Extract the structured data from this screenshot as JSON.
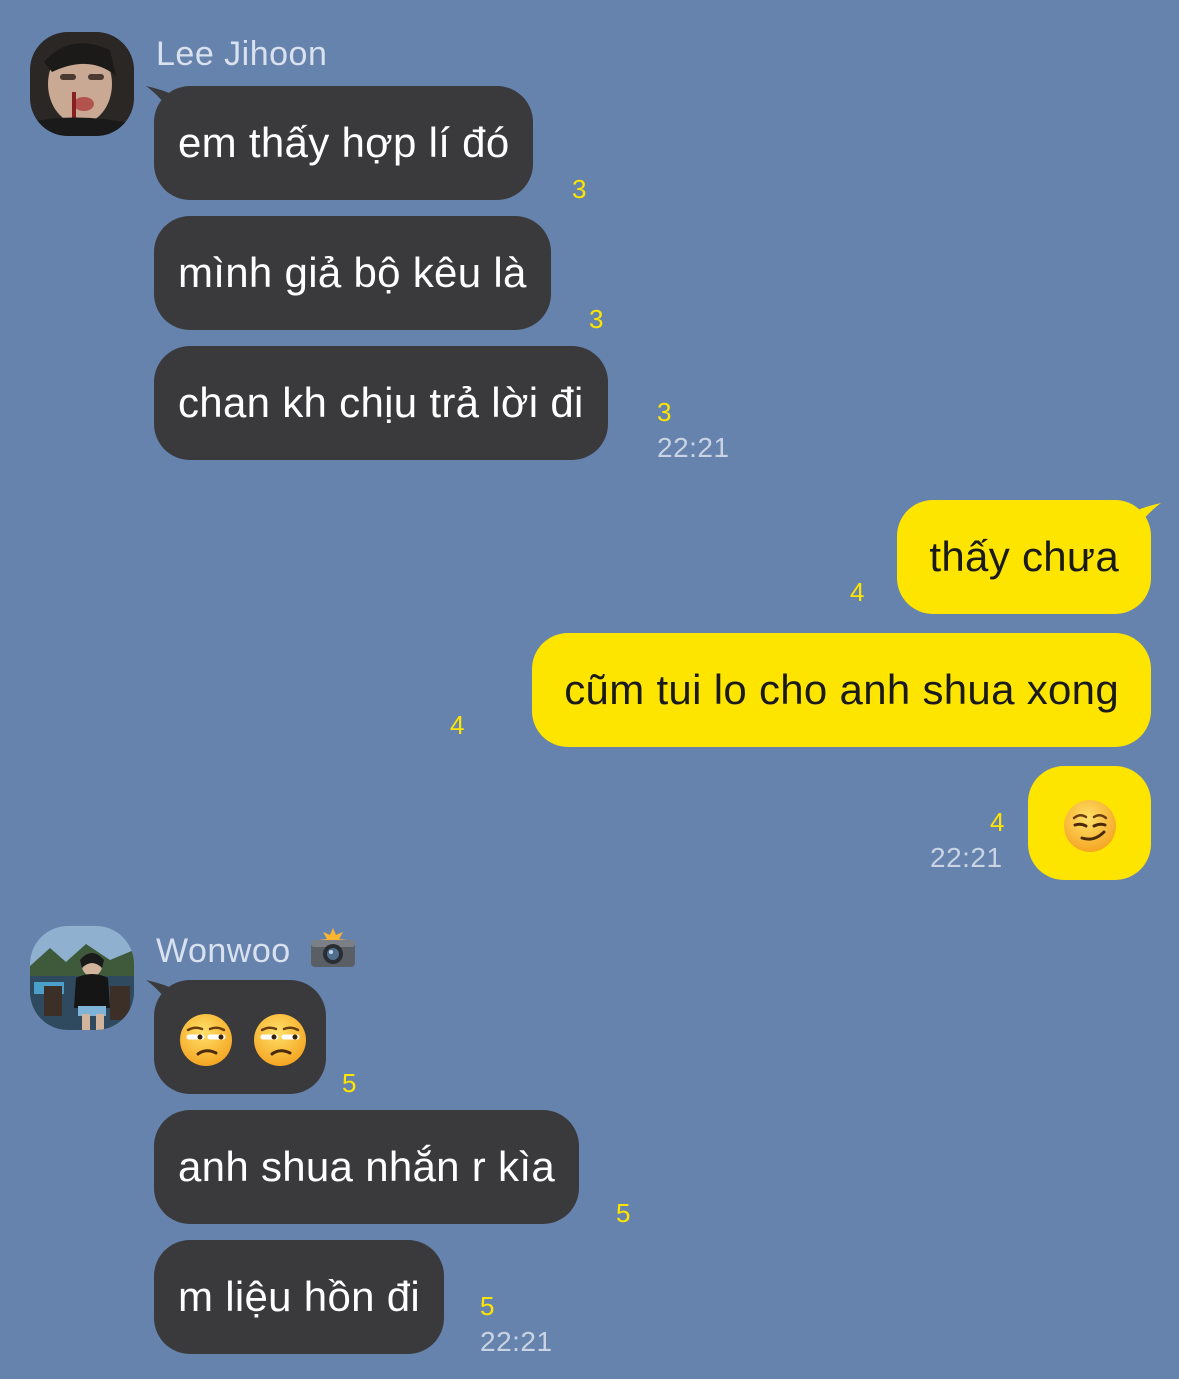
{
  "colors": {
    "background": "#6683ad",
    "incoming_bubble": "#3a3a3c",
    "outgoing_bubble": "#fee500",
    "unread_count": "#fee500",
    "sender_name": "#d9e1ee",
    "timestamp": "#c9d3e3"
  },
  "groups": [
    {
      "sender": "Lee Jihoon",
      "avatar_icon": "profile-photo-lee-jihoon",
      "messages": [
        {
          "text": "em thấy hợp lí đó",
          "unread": "3"
        },
        {
          "text": "mình giả bộ kêu là",
          "unread": "3"
        },
        {
          "text": "chan kh chịu trả lời đi",
          "unread": "3",
          "time": "22:21"
        }
      ]
    },
    {
      "sender": "me",
      "messages": [
        {
          "text": "thấy chưa",
          "unread": "4"
        },
        {
          "text": "cũm tui lo cho anh shua xong",
          "unread": "4"
        },
        {
          "emoji": "smirking-face-emoji",
          "unread": "4",
          "time": "22:21"
        }
      ]
    },
    {
      "sender": "Wonwoo",
      "sender_badge_icon": "camera-with-flash-icon",
      "avatar_icon": "profile-photo-wonwoo",
      "messages": [
        {
          "emoji": "unamused-face-emoji x2",
          "unread": "5"
        },
        {
          "text": "anh shua nhắn r kìa",
          "unread": "5"
        },
        {
          "text": "m liệu hồn đi",
          "unread": "5",
          "time": "22:21"
        }
      ]
    }
  ]
}
